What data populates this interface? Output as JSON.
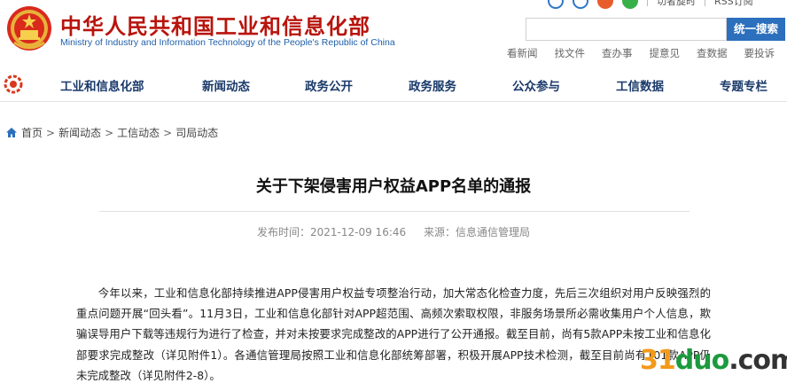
{
  "header": {
    "title": "中华人民共和国工业和信息化部",
    "subtitle": "Ministry of Industry and Information Technology of the People's Republic of China",
    "top_links": [
      "切者旋时",
      "RSS订阅"
    ],
    "search": {
      "placeholder": "",
      "button_label": "统一搜索"
    },
    "quick_links": [
      "看新闻",
      "找文件",
      "查办事",
      "提意见",
      "查数据",
      "要投诉"
    ]
  },
  "nav": {
    "items": [
      "工业和信息化部",
      "新闻动态",
      "政务公开",
      "政务服务",
      "公众参与",
      "工信数据",
      "专题专栏"
    ]
  },
  "breadcrumb": [
    "首页",
    "新闻动态",
    "工信动态",
    "司局动态"
  ],
  "article": {
    "title": "关于下架侵害用户权益APP名单的通报",
    "published": "发布时间：2021-12-09 16:46",
    "source": "来源：信息通信管理局",
    "paragraph": "今年以来，工业和信息化部持续推进APP侵害用户权益专项整治行动，加大常态化检查力度，先后三次组织对用户反映强烈的重点问题开展“回头看”。11月3日，工业和信息化部针对APP超范围、高频次索取权限，非服务场景所必需收集用户个人信息，欺骗误导用户下载等违规行为进行了检查，并对未按要求完成整改的APP进行了公开通报。截至目前，尚有5款APP未按工业和信息化部要求完成整改（详见附件1）。各通信管理局按照工业和信息化部统筹部署，积极开展APP技术检测，截至目前尚有101款APP仍未完成整改（详见附件2-8）。"
  },
  "watermark": {
    "num": "31",
    "d": "duo",
    "dom": ".com"
  },
  "colors": {
    "brand_red": "#b8140c",
    "nav_text": "#1a3a6a",
    "search_blue": "#2c6fbd"
  }
}
